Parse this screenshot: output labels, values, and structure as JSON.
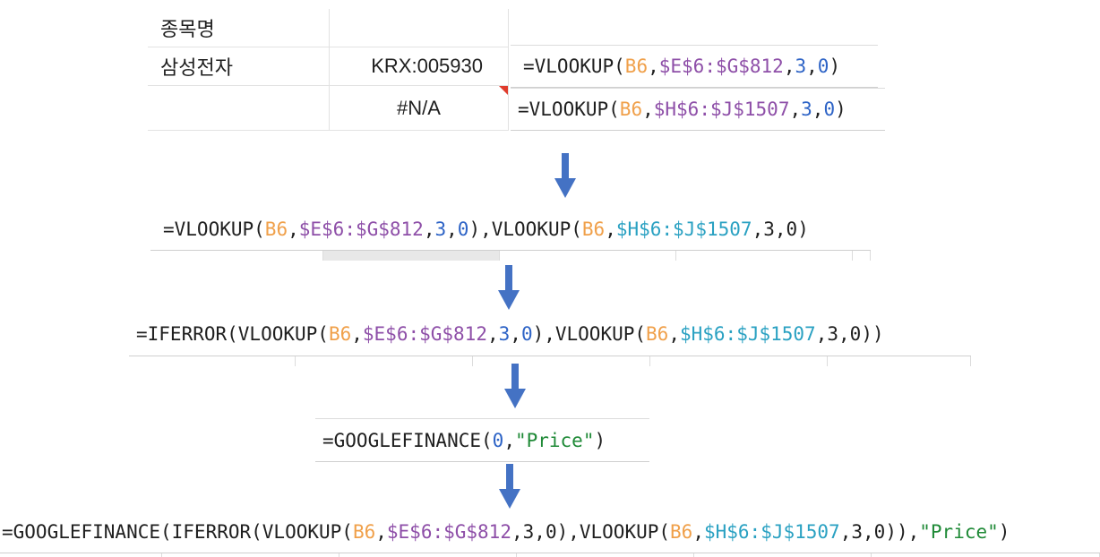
{
  "sheet": {
    "header_label": "종목명",
    "row1": {
      "name": "삼성전자",
      "ticker": "KRX:005930"
    },
    "row2": {
      "result": "#N/A"
    }
  },
  "formulas": {
    "f1": [
      {
        "t": "=VLOOKUP(",
        "c": "plain"
      },
      {
        "t": "B6",
        "c": "ref"
      },
      {
        "t": ",",
        "c": "plain"
      },
      {
        "t": "$E$6:$G$812",
        "c": "range1"
      },
      {
        "t": ",",
        "c": "plain"
      },
      {
        "t": "3",
        "c": "num"
      },
      {
        "t": ",",
        "c": "plain"
      },
      {
        "t": "0",
        "c": "num"
      },
      {
        "t": ")",
        "c": "plain"
      }
    ],
    "f2": [
      {
        "t": "=VLOOKUP(",
        "c": "plain"
      },
      {
        "t": "B6",
        "c": "ref"
      },
      {
        "t": ",",
        "c": "plain"
      },
      {
        "t": "$H$6:$J$1507",
        "c": "range1"
      },
      {
        "t": ",",
        "c": "plain"
      },
      {
        "t": "3",
        "c": "num"
      },
      {
        "t": ",",
        "c": "plain"
      },
      {
        "t": "0",
        "c": "num"
      },
      {
        "t": ")",
        "c": "plain"
      }
    ],
    "f3": [
      {
        "t": "=VLOOKUP(",
        "c": "plain"
      },
      {
        "t": "B6",
        "c": "ref"
      },
      {
        "t": ",",
        "c": "plain"
      },
      {
        "t": "$E$6:$G$812",
        "c": "range1"
      },
      {
        "t": ",",
        "c": "plain"
      },
      {
        "t": "3",
        "c": "num"
      },
      {
        "t": ",",
        "c": "plain"
      },
      {
        "t": "0",
        "c": "num"
      },
      {
        "t": "),VLOOKUP(",
        "c": "plain"
      },
      {
        "t": "B6",
        "c": "ref"
      },
      {
        "t": ",",
        "c": "plain"
      },
      {
        "t": "$H$6:$J$1507",
        "c": "range2"
      },
      {
        "t": ",",
        "c": "plain"
      },
      {
        "t": "3",
        "c": "plain"
      },
      {
        "t": ",",
        "c": "plain"
      },
      {
        "t": "0",
        "c": "plain"
      },
      {
        "t": ")",
        "c": "plain"
      }
    ],
    "f4": [
      {
        "t": "=IFERROR(VLOOKUP(",
        "c": "plain"
      },
      {
        "t": "B6",
        "c": "ref"
      },
      {
        "t": ",",
        "c": "plain"
      },
      {
        "t": "$E$6:$G$812",
        "c": "range1"
      },
      {
        "t": ",",
        "c": "plain"
      },
      {
        "t": "3",
        "c": "num"
      },
      {
        "t": ",",
        "c": "plain"
      },
      {
        "t": "0",
        "c": "num"
      },
      {
        "t": "),VLOOKUP(",
        "c": "plain"
      },
      {
        "t": "B6",
        "c": "ref"
      },
      {
        "t": ",",
        "c": "plain"
      },
      {
        "t": "$H$6:$J$1507",
        "c": "range2"
      },
      {
        "t": ",",
        "c": "plain"
      },
      {
        "t": "3",
        "c": "plain"
      },
      {
        "t": ",",
        "c": "plain"
      },
      {
        "t": "0",
        "c": "plain"
      },
      {
        "t": "))",
        "c": "plain"
      }
    ],
    "f5": [
      {
        "t": "=GOOGLEFINANCE(",
        "c": "plain"
      },
      {
        "t": "0",
        "c": "num"
      },
      {
        "t": ",",
        "c": "plain"
      },
      {
        "t": "\"Price\"",
        "c": "str"
      },
      {
        "t": ")",
        "c": "plain"
      }
    ],
    "f6": [
      {
        "t": "=GOOGLEFINANCE(IFERROR(VLOOKUP(",
        "c": "plain"
      },
      {
        "t": "B6",
        "c": "ref"
      },
      {
        "t": ",",
        "c": "plain"
      },
      {
        "t": "$E$6:$G$812",
        "c": "range1"
      },
      {
        "t": ",",
        "c": "plain"
      },
      {
        "t": "3",
        "c": "plain"
      },
      {
        "t": ",",
        "c": "plain"
      },
      {
        "t": "0",
        "c": "plain"
      },
      {
        "t": "),VLOOKUP(",
        "c": "plain"
      },
      {
        "t": "B6",
        "c": "ref"
      },
      {
        "t": ",",
        "c": "plain"
      },
      {
        "t": "$H$6:$J$1507",
        "c": "range2"
      },
      {
        "t": ",",
        "c": "plain"
      },
      {
        "t": "3",
        "c": "plain"
      },
      {
        "t": ",",
        "c": "plain"
      },
      {
        "t": "0",
        "c": "plain"
      },
      {
        "t": ")),",
        "c": "plain"
      },
      {
        "t": "\"Price\"",
        "c": "str"
      },
      {
        "t": ")",
        "c": "plain"
      }
    ]
  },
  "colors": {
    "ref": "#f0a04a",
    "range1": "#8e4fa8",
    "range2": "#2aa1c2",
    "number": "#2d63c6",
    "string": "#1f8a37",
    "arrow": "#4472c4",
    "error_marker": "#e03b2c"
  },
  "icons": {
    "step_arrow": "arrow-down-icon"
  }
}
